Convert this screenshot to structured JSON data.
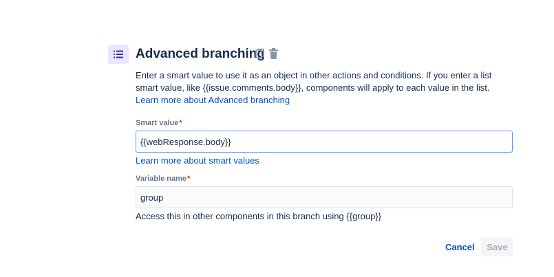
{
  "component": {
    "icon": "list-branch-icon",
    "title": "Advanced branching",
    "actions": [
      {
        "icon": "copy-icon"
      },
      {
        "icon": "trash-icon"
      }
    ],
    "description": {
      "text": "Enter a smart value to use it as an object in other actions and conditions. If you enter a list smart value, like {{issue.comments.body}}, components will apply to each value in the list. ",
      "link_text": "Learn more about Advanced branching"
    }
  },
  "smart_value": {
    "label": "Smart value",
    "required_marker": "*",
    "value": "{{webResponse.body}}",
    "helper_link": "Learn more about smart values"
  },
  "variable_name": {
    "label": "Variable name",
    "required_marker": "*",
    "value": "group",
    "helper_text": "Access this in other components in this branch using {{group}}"
  },
  "footer": {
    "cancel_label": "Cancel",
    "save_label": "Save"
  },
  "colors": {
    "accent_link": "#0052cc",
    "icon_bg": "#eae6ff",
    "focus_border": "#4c9aff",
    "required": "#de350b"
  }
}
